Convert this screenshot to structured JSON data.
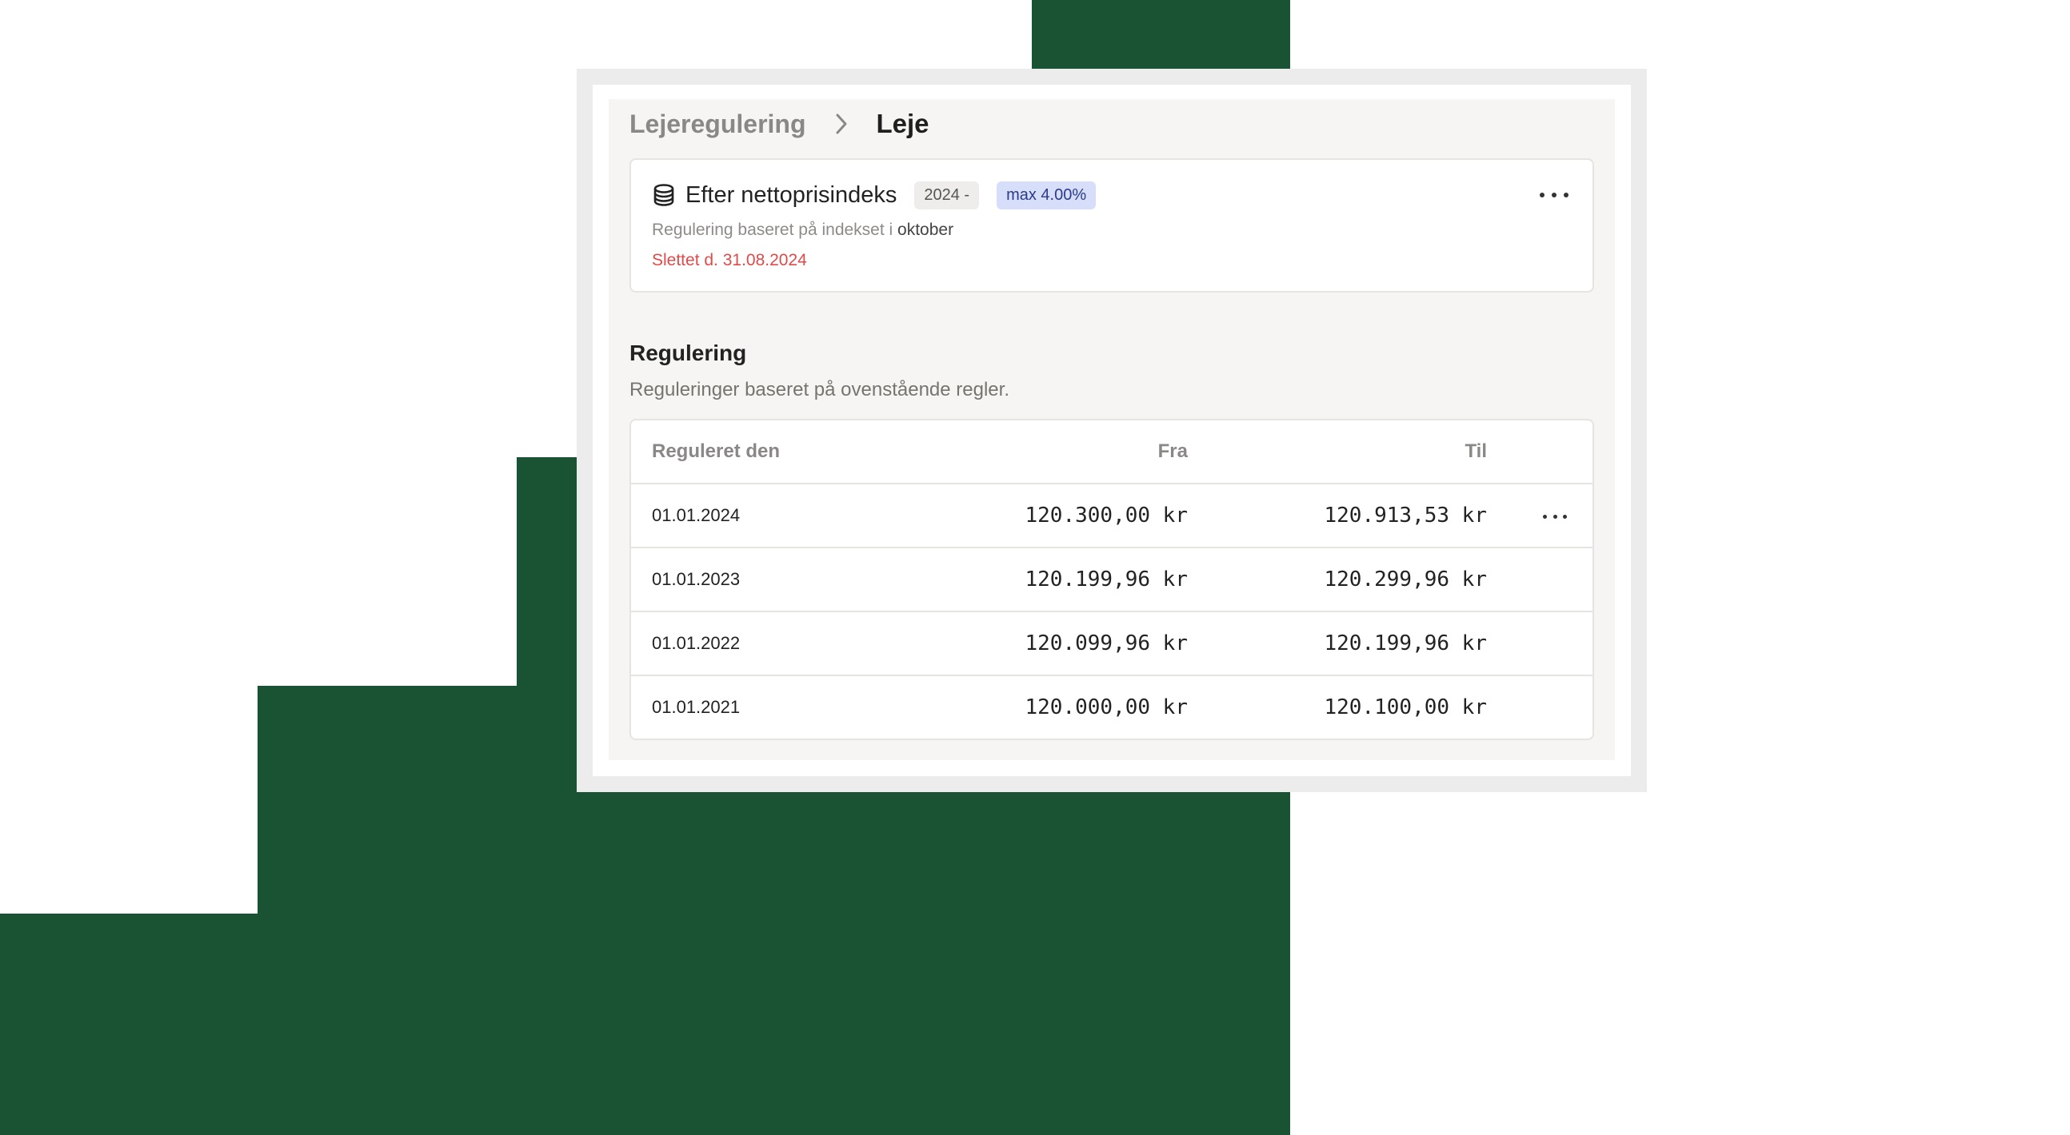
{
  "breadcrumb": {
    "parent": "Lejeregulering",
    "current": "Leje"
  },
  "rule_card": {
    "icon": "database-icon",
    "title": "Efter nettoprisindeks",
    "year_badge": "2024 -",
    "max_badge": "max 4.00%",
    "subtitle_prefix": "Regulering baseret på indekset i",
    "subtitle_month": "oktober",
    "deleted": "Slettet d. 31.08.2024"
  },
  "section": {
    "title": "Regulering",
    "subtitle": "Reguleringer baseret på ovenstående regler."
  },
  "table": {
    "headers": {
      "date": "Reguleret den",
      "from": "Fra",
      "to": "Til"
    },
    "rows": [
      {
        "date": "01.01.2024",
        "from": "120.300,00 kr",
        "to": "120.913,53 kr"
      },
      {
        "date": "01.01.2023",
        "from": "120.199,96 kr",
        "to": "120.299,96 kr"
      },
      {
        "date": "01.01.2022",
        "from": "120.099,96 kr",
        "to": "120.199,96 kr"
      },
      {
        "date": "01.01.2021",
        "from": "120.000,00 kr",
        "to": "120.100,00 kr"
      }
    ]
  },
  "colors": {
    "background_green": "#1a5234",
    "deleted_red": "#e14a4a",
    "max_badge_bg": "#d7defa",
    "max_badge_text": "#2c3a8c"
  }
}
